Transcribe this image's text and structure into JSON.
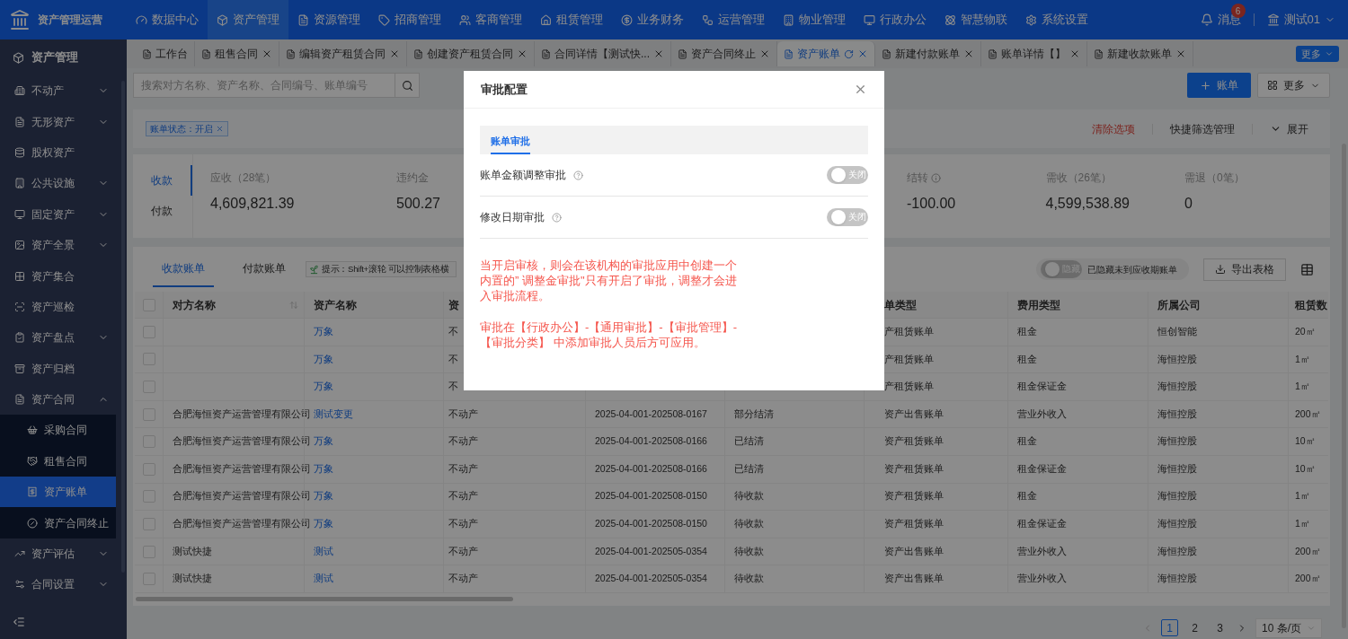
{
  "topbar": {
    "app_name": "资产管理运营",
    "nav": [
      {
        "label": "数据中心",
        "selected": false
      },
      {
        "label": "资产管理",
        "selected": true
      },
      {
        "label": "资源管理",
        "selected": false
      },
      {
        "label": "招商管理",
        "selected": false
      },
      {
        "label": "客商管理",
        "selected": false
      },
      {
        "label": "租赁管理",
        "selected": false
      },
      {
        "label": "业务财务",
        "selected": false
      },
      {
        "label": "运营管理",
        "selected": false
      },
      {
        "label": "物业管理",
        "selected": false
      },
      {
        "label": "行政办公",
        "selected": false
      },
      {
        "label": "智慧物联",
        "selected": false
      },
      {
        "label": "系统设置",
        "selected": false
      }
    ],
    "messages": {
      "label": "消息",
      "badge": "6"
    },
    "user": "测试01"
  },
  "sidebar": {
    "title": "资产管理",
    "items": [
      {
        "label": "不动产",
        "kind": "group",
        "expanded": false
      },
      {
        "label": "无形资产",
        "kind": "group",
        "expanded": false
      },
      {
        "label": "股权资产",
        "kind": "link",
        "selected": false
      },
      {
        "label": "公共设施",
        "kind": "group",
        "expanded": false
      },
      {
        "label": "固定资产",
        "kind": "group",
        "expanded": false
      },
      {
        "label": "资产全景",
        "kind": "group",
        "expanded": false
      },
      {
        "label": "资产集合",
        "kind": "link",
        "selected": false
      },
      {
        "label": "资产巡检",
        "kind": "link",
        "selected": false
      },
      {
        "label": "资产盘点",
        "kind": "group",
        "expanded": false
      },
      {
        "label": "资产归档",
        "kind": "link",
        "selected": false
      },
      {
        "label": "资产合同",
        "kind": "group",
        "expanded": true,
        "children": [
          {
            "label": "采购合同",
            "selected": false
          },
          {
            "label": "租售合同",
            "selected": false
          },
          {
            "label": "资产账单",
            "selected": true
          },
          {
            "label": "资产合同终止",
            "selected": false
          }
        ]
      },
      {
        "label": "资产评估",
        "kind": "group",
        "expanded": false
      },
      {
        "label": "合同设置",
        "kind": "group",
        "expanded": false
      }
    ]
  },
  "page_tabs": {
    "tabs": [
      {
        "label": "工作台",
        "selected": false,
        "closable": false
      },
      {
        "label": "租售合同",
        "selected": false,
        "closable": true
      },
      {
        "label": "编辑资产租赁合同",
        "selected": false,
        "closable": true
      },
      {
        "label": "创建资产租赁合同",
        "selected": false,
        "closable": true
      },
      {
        "label": "合同详情【测试快...",
        "selected": false,
        "closable": true
      },
      {
        "label": "资产合同终止",
        "selected": false,
        "closable": true
      },
      {
        "label": "资产账单",
        "selected": true,
        "closable": true
      },
      {
        "label": "新建付款账单",
        "selected": false,
        "closable": true
      },
      {
        "label": "账单详情【】",
        "selected": false,
        "closable": true
      },
      {
        "label": "新建收款账单",
        "selected": false,
        "closable": true
      }
    ],
    "more_button": "更多"
  },
  "toolbar": {
    "search_placeholder": "搜索对方名称、资产名称、合同编号、账单编号",
    "add_button": "账单",
    "more_button": "更多"
  },
  "filters": {
    "tags": [
      "账单状态：开启"
    ],
    "clear": "清除选项",
    "manage": "快捷筛选管理",
    "expand": "展开"
  },
  "summary": {
    "tabs": [
      {
        "label": "收款",
        "selected": true
      },
      {
        "label": "付款",
        "selected": false
      }
    ],
    "stats_left": [
      {
        "label": "应收（28笔）",
        "value": "4,609,821.39",
        "info": false
      },
      {
        "label": "违约金",
        "value": "500.27",
        "info": false
      }
    ],
    "stats_right": [
      {
        "label": "结转",
        "value": "-100.00",
        "info": true
      },
      {
        "label": "需收（26笔）",
        "value": "4,599,538.89",
        "info": false
      },
      {
        "label": "需退（0笔）",
        "value": "0",
        "info": false
      }
    ]
  },
  "bills": {
    "tabs": [
      {
        "label": "收款账单",
        "selected": true
      },
      {
        "label": "付款账单",
        "selected": false
      }
    ],
    "hint": "提示：Shift+滚轮 可以控制表格横",
    "hide_toggle": {
      "label": "隐藏",
      "on": false,
      "caption": "已隐藏未到应收期账单"
    },
    "export_button": "导出表格",
    "table": {
      "header_checked": false,
      "columns": [
        {
          "label": "对方名称",
          "sortable": true
        },
        {
          "label": "资产名称"
        },
        {
          "label": "资"
        },
        null,
        null,
        {
          "label": "单类型"
        },
        {
          "label": "费用类型"
        },
        {
          "label": "所属公司"
        },
        {
          "label": "租赁数"
        }
      ],
      "rows": [
        {
          "checked": false,
          "cells": [
            null,
            "万象",
            "不",
            null,
            null,
            "产租赁账单",
            "租金",
            "恒创智能",
            "20㎡"
          ]
        },
        {
          "checked": false,
          "cells": [
            null,
            "万象",
            "不",
            null,
            null,
            "产租赁账单",
            "租金",
            "海恒控股",
            "1㎡"
          ]
        },
        {
          "checked": false,
          "cells": [
            null,
            "万象",
            "不",
            null,
            null,
            "产租赁账单",
            "租金保证金",
            "海恒控股",
            "1㎡"
          ]
        },
        {
          "checked": false,
          "cells": [
            "合肥海恒资产运营管理有限公司",
            "测试变更",
            "不动产",
            "2025-04-001-202508-0167",
            "部分结清",
            "资产出售账单",
            "营业外收入",
            "海恒控股",
            "200㎡"
          ]
        },
        {
          "checked": false,
          "cells": [
            "合肥海恒资产运营管理有限公司",
            "万象",
            "不动产",
            "2025-04-001-202508-0166",
            "已结清",
            "资产租赁账单",
            "租金",
            "海恒控股",
            "10㎡"
          ]
        },
        {
          "checked": false,
          "cells": [
            "合肥海恒资产运营管理有限公司",
            "万象",
            "不动产",
            "2025-04-001-202508-0166",
            "已结清",
            "资产租赁账单",
            "租金保证金",
            "海恒控股",
            "10㎡"
          ]
        },
        {
          "checked": false,
          "cells": [
            "合肥海恒资产运营管理有限公司",
            "万象",
            "不动产",
            "2025-04-001-202508-0150",
            "待收款",
            "资产租赁账单",
            "租金",
            "海恒控股",
            "1㎡"
          ]
        },
        {
          "checked": false,
          "cells": [
            "合肥海恒资产运营管理有限公司",
            "万象",
            "不动产",
            "2025-04-001-202508-0150",
            "待收款",
            "资产租赁账单",
            "租金保证金",
            "海恒控股",
            "1㎡"
          ]
        },
        {
          "checked": false,
          "cells": [
            "测试快捷",
            "测试",
            "不动产",
            "2025-04-001-202505-0354",
            "待收款",
            "资产出售账单",
            "营业外收入",
            "海恒控股",
            "200㎡"
          ]
        },
        {
          "checked": false,
          "cells": [
            "测试快捷",
            "测试",
            "不动产",
            "2025-04-001-202505-0354",
            "待收款",
            "资产出售账单",
            "营业外收入",
            "海恒控股",
            "200㎡"
          ]
        }
      ]
    },
    "pagination": {
      "pages": [
        {
          "label": "1",
          "selected": true
        },
        {
          "label": "2",
          "selected": false
        },
        {
          "label": "3",
          "selected": false
        }
      ],
      "page_size": "10 条/页"
    }
  },
  "modal": {
    "title": "审批配置",
    "tabs": [
      {
        "label": "账单审批",
        "selected": true
      }
    ],
    "settings": [
      {
        "label": "账单金额调整审批",
        "on": false,
        "toggle_label": "关闭"
      },
      {
        "label": "修改日期审批",
        "on": false,
        "toggle_label": "关闭"
      }
    ],
    "notes": [
      "当开启审核，则会在该机构的审批应用中创建一个内置的” 调整金审批\"只有开启了审批，调整才会进入审批流程。",
      "审批在【行政办公】-【通用审批】-【审批管理】-【审批分类】 中添加审批人员后方可应用。"
    ]
  }
}
